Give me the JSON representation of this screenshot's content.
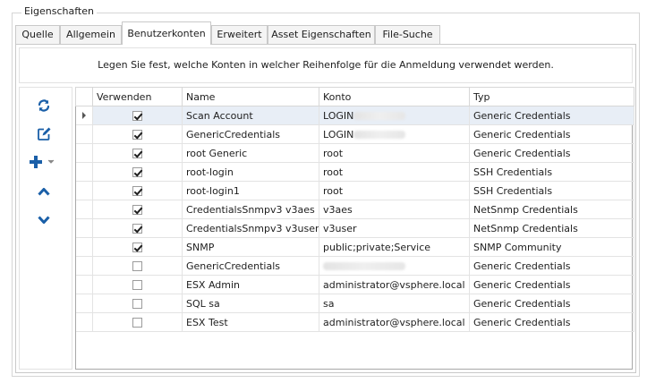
{
  "groupbox": {
    "title": "Eigenschaften"
  },
  "tabs": [
    {
      "label": "Quelle"
    },
    {
      "label": "Allgemein"
    },
    {
      "label": "Benutzerkonten"
    },
    {
      "label": "Erweitert"
    },
    {
      "label": "Asset Eigenschaften"
    },
    {
      "label": "File-Suche"
    }
  ],
  "active_tab": "Benutzerkonten",
  "description": "Legen Sie fest, welche Konten in welcher Reihenfolge für die Anmeldung verwendet werden.",
  "toolbar": {
    "buttons": [
      {
        "icon": "refresh-icon"
      },
      {
        "icon": "edit-icon"
      },
      {
        "icon": "add-icon"
      },
      {
        "icon": "move-up-icon"
      },
      {
        "icon": "move-down-icon"
      }
    ]
  },
  "grid": {
    "columns": [
      "Verwenden",
      "Name",
      "Konto",
      "Typ"
    ],
    "rows": [
      {
        "use": true,
        "name": "Scan Account",
        "account": "LOGIN",
        "account_redacted": true,
        "type": "Generic Credentials"
      },
      {
        "use": true,
        "name": "GenericCredentials",
        "account": "LOGIN",
        "account_redacted": true,
        "type": "Generic Credentials"
      },
      {
        "use": true,
        "name": "root Generic",
        "account": "root",
        "account_redacted": false,
        "type": "Generic Credentials"
      },
      {
        "use": true,
        "name": "root-login",
        "account": "root",
        "account_redacted": false,
        "type": "SSH Credentials"
      },
      {
        "use": true,
        "name": "root-login1",
        "account": "root",
        "account_redacted": false,
        "type": "SSH Credentials"
      },
      {
        "use": true,
        "name": "CredentialsSnmpv3 v3aes",
        "account": "v3aes",
        "account_redacted": false,
        "type": "NetSnmp Credentials"
      },
      {
        "use": true,
        "name": "CredentialsSnmpv3 v3user",
        "account": "v3user",
        "account_redacted": false,
        "type": "NetSnmp Credentials"
      },
      {
        "use": true,
        "name": "SNMP",
        "account": "public;private;Service",
        "account_redacted": false,
        "type": "SNMP Community"
      },
      {
        "use": false,
        "name": "GenericCredentials",
        "account": "",
        "account_redacted": true,
        "type": "Generic Credentials"
      },
      {
        "use": false,
        "name": "ESX Admin",
        "account": "administrator@vsphere.local",
        "account_redacted": false,
        "type": "Generic Credentials"
      },
      {
        "use": false,
        "name": "SQL sa",
        "account": "sa",
        "account_redacted": false,
        "type": "Generic Credentials"
      },
      {
        "use": false,
        "name": "ESX Test",
        "account": "administrator@vsphere.local",
        "account_redacted": false,
        "type": "Generic Credentials"
      }
    ],
    "current_row": 0
  },
  "colors": {
    "accent_icon": "#1a5fa8",
    "selected_row": "#e8eef6",
    "border": "#c9c9c9"
  }
}
